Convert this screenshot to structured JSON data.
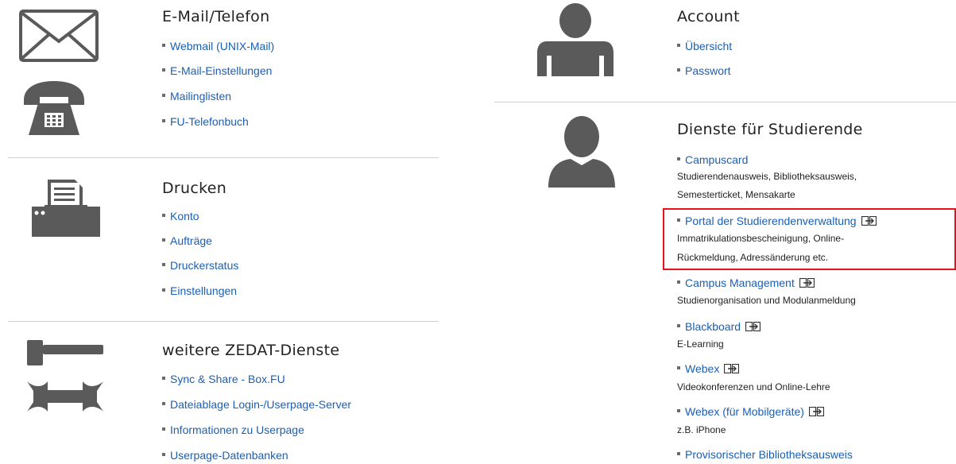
{
  "left": {
    "email": {
      "title": "E-Mail/Telefon",
      "links": [
        "Webmail (UNIX-Mail)",
        "E-Mail-Einstellungen",
        "Mailinglisten",
        "FU-Telefonbuch"
      ],
      "icons": [
        "envelope-icon",
        "telephone-icon"
      ]
    },
    "print": {
      "title": "Drucken",
      "links": [
        "Konto",
        "Aufträge",
        "Druckerstatus",
        "Einstellungen"
      ],
      "icons": [
        "printer-icon"
      ]
    },
    "zedat": {
      "title": "weitere ZEDAT-Dienste",
      "links": [
        "Sync & Share - Box.FU",
        "Dateiablage Login-/Userpage-Server",
        "Informationen zu Userpage",
        "Userpage-Datenbanken"
      ],
      "icons": [
        "hammer-icon",
        "wrench-icon"
      ]
    }
  },
  "right": {
    "account": {
      "title": "Account",
      "links": [
        "Übersicht",
        "Passwort"
      ],
      "icons": [
        "user-silhouette-icon"
      ]
    },
    "students": {
      "title": "Dienste für Studierende",
      "icons": [
        "student-avatar-icon"
      ],
      "items": [
        {
          "label": "Campuscard",
          "desc1": "Studierendenausweis, Bibliotheksausweis,",
          "desc2": "Semesterticket, Mensakarte",
          "external": false
        },
        {
          "label": "Portal der Studierendenverwaltung",
          "desc1": "Immatrikulationsbescheinigung, Online-",
          "desc2": "Rückmeldung, Adressänderung etc.",
          "external": true,
          "highlighted": true
        },
        {
          "label": "Campus Management",
          "desc1": "Studienorganisation und Modulanmeldung",
          "desc2": "",
          "external": true
        },
        {
          "label": "Blackboard",
          "desc1": "E-Learning",
          "desc2": "",
          "external": true
        },
        {
          "label": "Webex",
          "desc1": "Videokonferenzen und Online-Lehre",
          "desc2": "",
          "external": true
        },
        {
          "label": "Webex (für Mobilgeräte)",
          "desc1": "z.B. iPhone",
          "desc2": "",
          "external": true
        },
        {
          "label": "Provisorischer Bibliotheksausweis",
          "desc1": "",
          "desc2": "",
          "external": false
        }
      ]
    }
  },
  "colors": {
    "link": "#1a5fb4",
    "icon": "#5a5a5a",
    "highlight": "#e8111b",
    "divider": "#d0d0d0"
  }
}
